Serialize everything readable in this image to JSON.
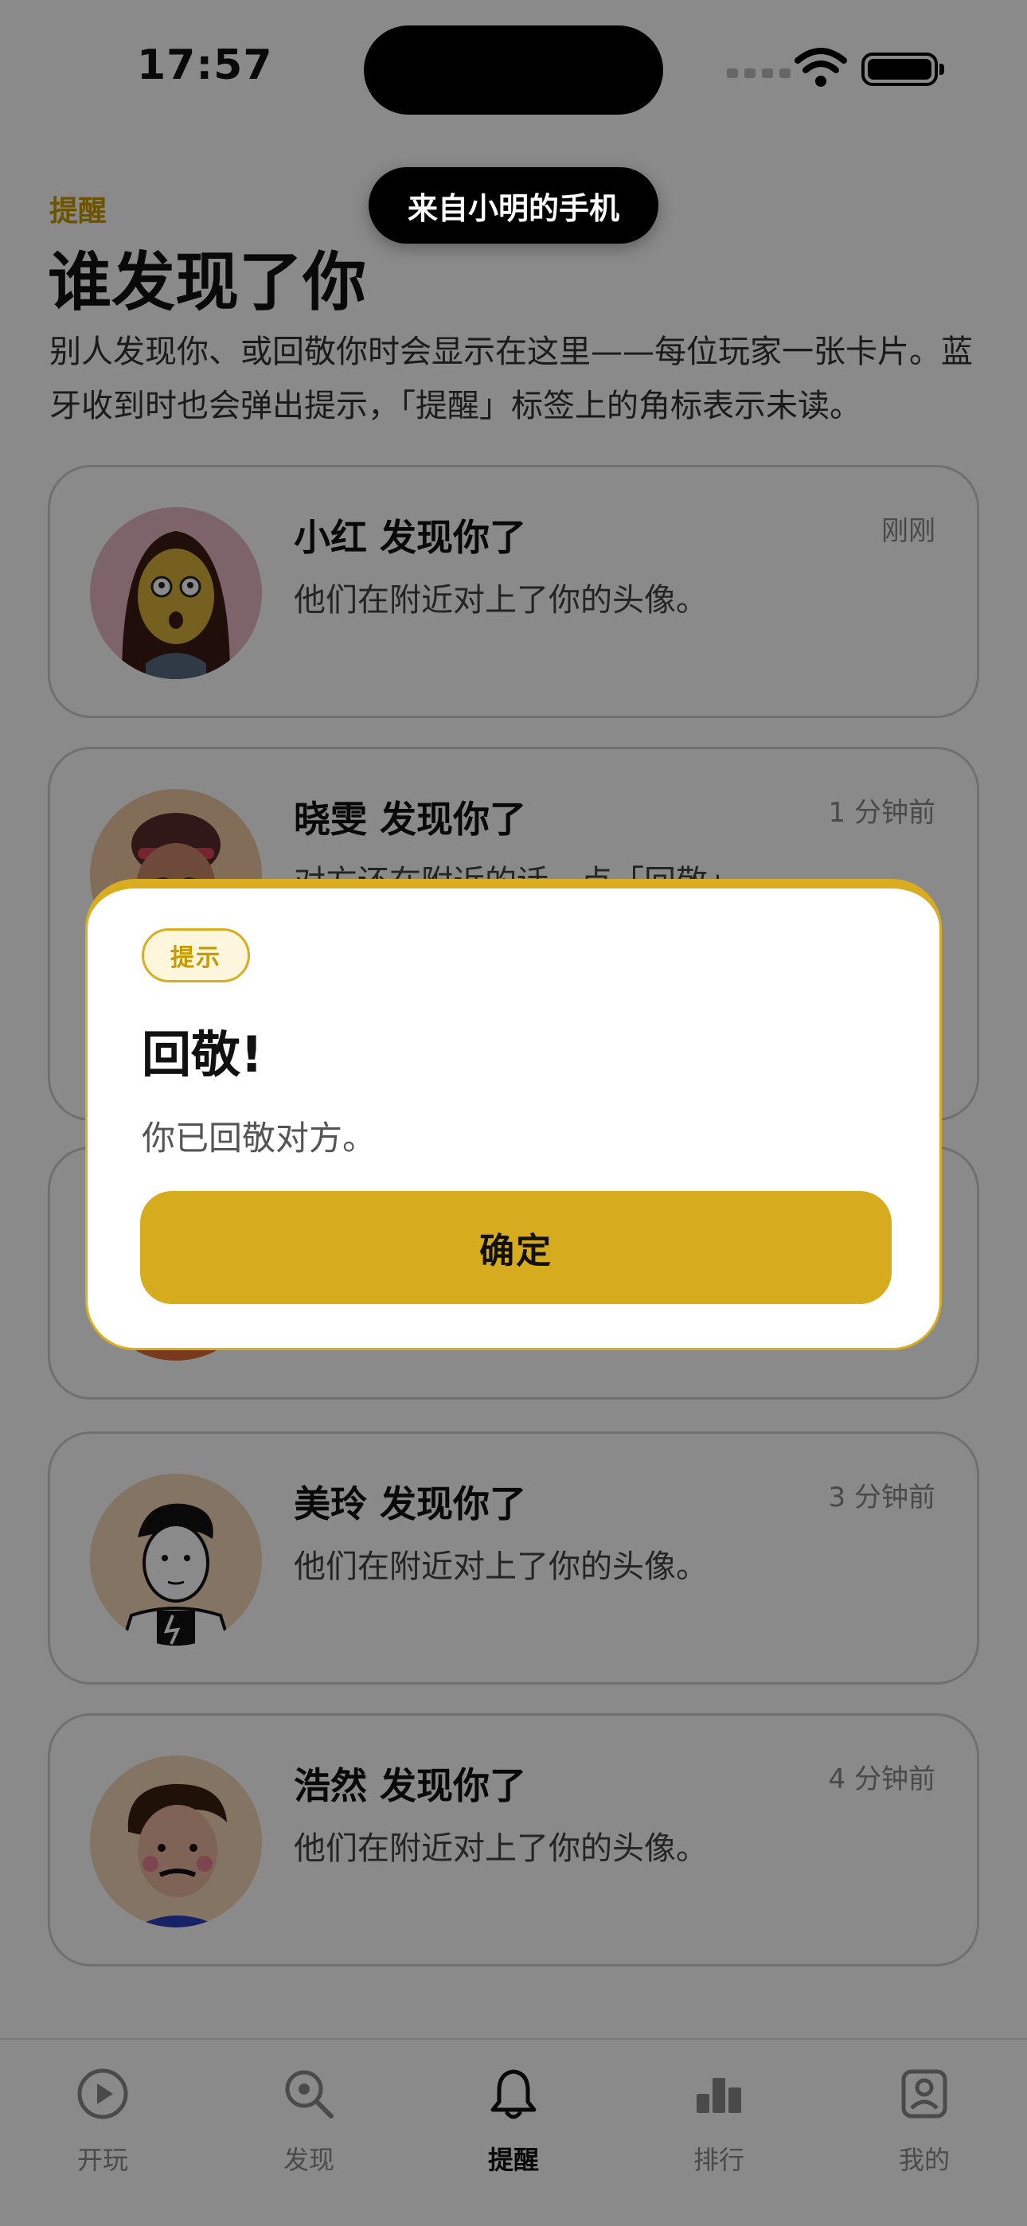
{
  "status_bar": {
    "time": "17:57"
  },
  "toast": "来自小明的手机",
  "header": {
    "eyebrow": "提醒",
    "title": "谁发现了你",
    "description": "别人发现你、或回敬你时会显示在这里——每位玩家一张卡片。蓝牙收到时也会弹出提示，「提醒」标签上的角标表示未读。"
  },
  "cards": [
    {
      "title": "小红 发现你了",
      "time": "刚刚",
      "subtitle": "他们在附近对上了你的头像。"
    },
    {
      "title": "晓雯 发现你了",
      "time": "1 分钟前",
      "subtitle": "对方还在附近的话，点「回敬」"
    },
    {
      "title": "",
      "time": "",
      "subtitle": ""
    },
    {
      "title": "美玲 发现你了",
      "time": "3 分钟前",
      "subtitle": "他们在附近对上了你的头像。"
    },
    {
      "title": "浩然 发现你了",
      "time": "4 分钟前",
      "subtitle": "他们在附近对上了你的头像。"
    }
  ],
  "dialog": {
    "badge": "提示",
    "title": "回敬!",
    "body": "你已回敬对方。",
    "confirm_label": "确定"
  },
  "tabbar": {
    "items": [
      {
        "label": "开玩",
        "icon": "play-icon"
      },
      {
        "label": "发现",
        "icon": "search-icon"
      },
      {
        "label": "提醒",
        "icon": "bell-icon",
        "active": true
      },
      {
        "label": "排行",
        "icon": "leaderboard-icon"
      },
      {
        "label": "我的",
        "icon": "profile-icon"
      }
    ]
  },
  "colors": {
    "accent": "#d6ab1d",
    "eyebrow": "#c79a00",
    "overlay": "rgba(0,0,0,0.46)"
  }
}
